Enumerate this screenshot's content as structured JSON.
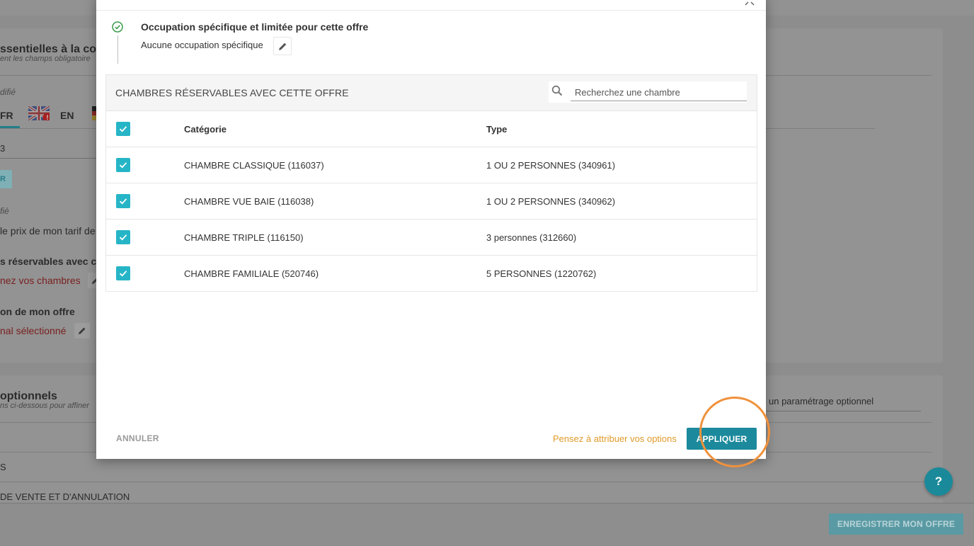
{
  "background": {
    "section1_title": "ssentielles à la conf",
    "section1_subtitle": "ent les champs obligatoire",
    "modified_label_1": "difié",
    "lang_fr": "FR",
    "lang_en": "EN",
    "field_fragment": "3",
    "chip_fragment": "R",
    "modified_label_2": "fié",
    "price_text": "le prix de mon tarif de",
    "rooms_heading": "s réservables avec cet",
    "rooms_link": "nez vos chambres",
    "offer_heading": "on de mon offre",
    "offer_link": "nal sélectionné",
    "section2_title": "optionnels",
    "section2_subtitle": "ns ci-dessous pour affiner",
    "optional_placeholder": "un paramétrage optionnel",
    "row_fragment_1": "S",
    "row_fragment_2": "DE VENTE ET D'ANNULATION",
    "save_button": "ENREGISTRER MON OFFRE",
    "help_button": "?"
  },
  "modal": {
    "step": {
      "title": "Occupation spécifique et limitée pour cette offre",
      "value": "Aucune occupation spécifique"
    },
    "rooms": {
      "title": "CHAMBRES RÉSERVABLES AVEC CETTE OFFRE",
      "search_placeholder": "Recherchez une chambre",
      "columns": {
        "category": "Catégorie",
        "type": "Type"
      },
      "items": [
        {
          "category": "CHAMBRE CLASSIQUE (116037)",
          "type": "1 OU 2 PERSONNES (340961)",
          "checked": true
        },
        {
          "category": "CHAMBRE VUE BAIE (116038)",
          "type": "1 OU 2 PERSONNES (340962)",
          "checked": true
        },
        {
          "category": "CHAMBRE TRIPLE (116150)",
          "type": "3 personnes (312660)",
          "checked": true
        },
        {
          "category": "CHAMBRE FAMILIALE (520746)",
          "type": "5 PERSONNES (1220762)",
          "checked": true
        }
      ]
    },
    "cancel_label": "ANNULER",
    "options_hint": "Pensez à attribuer vos options",
    "apply_label": "APPLIQUER"
  },
  "colors": {
    "accent": "#1c8a9c",
    "checkbox": "#26b5c6",
    "hint": "#e09a2a",
    "highlight": "#f0913c",
    "success": "#3a9a4a"
  },
  "icons": [
    "check-circle-icon",
    "pencil-icon",
    "search-icon",
    "checkbox-checked-icon",
    "close-icon",
    "uk-flag-icon",
    "de-flag-icon",
    "help-icon"
  ]
}
